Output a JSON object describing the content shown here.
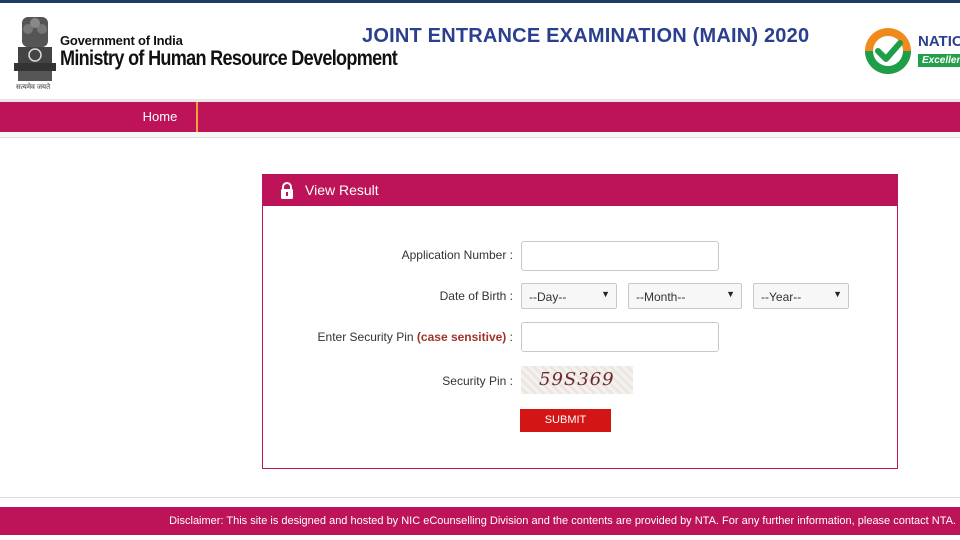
{
  "header": {
    "gov_line1": "Government of India",
    "gov_line2": "Ministry of Human Resource Development",
    "motto": "सत्यमेव जयते",
    "title": "JOINT ENTRANCE EXAMINATION (MAIN) 2020",
    "nta_name": "NATIO",
    "nta_tag": "Excellen"
  },
  "nav": {
    "home_label": "Home"
  },
  "panel": {
    "title": "View Result",
    "icon": "lock-icon",
    "application_label": "Application Number :",
    "dob_label": "Date of Birth :",
    "pin_label_prefix": "Enter Security Pin",
    "pin_label_highlight": "(case sensitive)",
    "pin_label_suffix": ":",
    "captcha_label": "Security Pin :",
    "captcha_value": "59S369",
    "day_select": "--Day--",
    "month_select": "--Month--",
    "year_select": "--Year--",
    "application_value": "",
    "pin_value": "",
    "submit_label": "SUBMIT"
  },
  "footer": {
    "disclaimer": "Disclaimer: This site is designed and hosted by NIC eCounselling Division and the contents are provided by NTA. For any further information, please contact NTA."
  },
  "colors": {
    "brand": "#bd1459",
    "title": "#2b3f8f",
    "submit": "#d41515",
    "accent_border": "#f3a33a"
  }
}
